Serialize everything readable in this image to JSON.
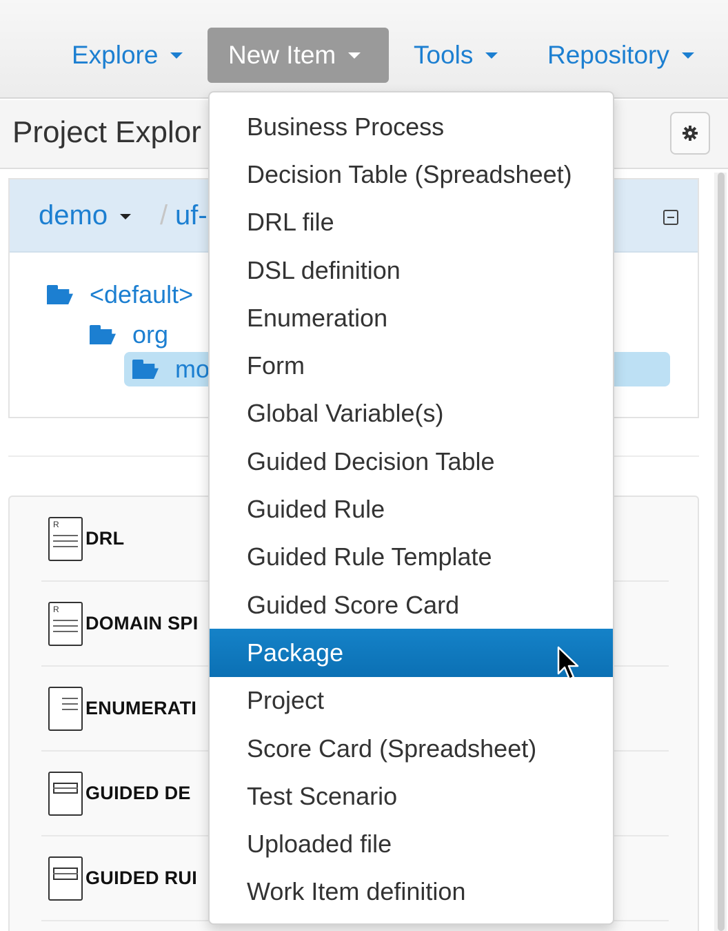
{
  "nav": {
    "items": [
      {
        "label": "Explore"
      },
      {
        "label": "New Item",
        "active": true
      },
      {
        "label": "Tools"
      },
      {
        "label": "Repository"
      }
    ]
  },
  "explorer": {
    "title": "Project Explor",
    "gear_icon": "gear-icon"
  },
  "breadcrumb": {
    "root": "demo",
    "separator": "/",
    "current": "uf-"
  },
  "tree": {
    "items": [
      {
        "label": "<default>"
      },
      {
        "label": "org"
      },
      {
        "label": "mo",
        "selected": true
      }
    ]
  },
  "assets": {
    "items": [
      {
        "label": "DRL",
        "icon": "rule-file-icon"
      },
      {
        "label": "DOMAIN SPI",
        "icon": "rule-file-icon"
      },
      {
        "label": "ENUMERATI",
        "icon": "list-file-icon"
      },
      {
        "label": "GUIDED DE",
        "icon": "table-file-icon"
      },
      {
        "label": "GUIDED RUI",
        "icon": "form-file-icon"
      }
    ]
  },
  "menu": {
    "items": [
      {
        "label": "Business Process"
      },
      {
        "label": "Decision Table (Spreadsheet)"
      },
      {
        "label": "DRL file"
      },
      {
        "label": "DSL definition"
      },
      {
        "label": "Enumeration"
      },
      {
        "label": "Form"
      },
      {
        "label": "Global Variable(s)"
      },
      {
        "label": "Guided Decision Table"
      },
      {
        "label": "Guided Rule"
      },
      {
        "label": "Guided Rule Template"
      },
      {
        "label": "Guided Score Card"
      },
      {
        "label": "Package",
        "highlighted": true
      },
      {
        "label": "Project"
      },
      {
        "label": "Score Card (Spreadsheet)"
      },
      {
        "label": "Test Scenario"
      },
      {
        "label": "Uploaded file"
      },
      {
        "label": "Work Item definition"
      }
    ]
  },
  "colors": {
    "link": "#1c7fd1",
    "menu_highlight": "#0f78bf",
    "nav_active": "#9a9a9a"
  }
}
